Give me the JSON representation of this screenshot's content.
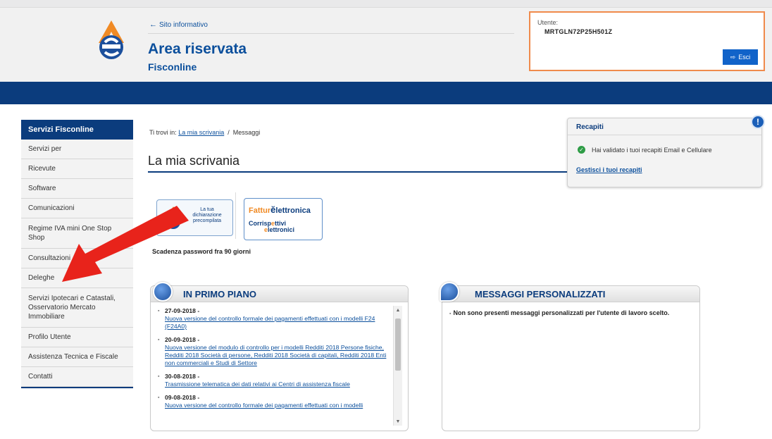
{
  "header": {
    "back_link": "Sito informativo",
    "title": "Area riservata",
    "subtitle": "Fisconline",
    "user_label": "Utente:",
    "user_code": "MRTGLN72P25H501Z",
    "logout_label": "Esci"
  },
  "sidebar": {
    "heading": "Servizi Fisconline",
    "items": [
      {
        "label": "Servizi per"
      },
      {
        "label": "Ricevute"
      },
      {
        "label": "Software"
      },
      {
        "label": "Comunicazioni"
      },
      {
        "label": "Regime IVA mini One Stop Shop"
      },
      {
        "label": "Consultazioni"
      },
      {
        "label": "Deleghe"
      },
      {
        "label": "Servizi Ipotecari e Catastali, Osservatorio Mercato Immobiliare"
      },
      {
        "label": "Profilo Utente"
      },
      {
        "label": "Assistenza Tecnica e Fiscale"
      },
      {
        "label": "Contatti"
      }
    ]
  },
  "breadcrumb": {
    "prefix": "Ti trovi in:",
    "link": "La mia scrivania",
    "separator": "/",
    "current": "Messaggi"
  },
  "main": {
    "title": "La mia scrivania",
    "password_notice": "Scadenza password fra 90 giorni"
  },
  "recapiti": {
    "title": "Recapiti",
    "message": "Hai validato i tuoi recapiti Email e Cellulare",
    "link": "Gestisci i tuoi recapiti"
  },
  "buttons": {
    "dichiarazione": "La tua dichiarazione precompilata",
    "fattura_part1": "Fattur",
    "fattura_part2": "lettronica",
    "corrisp_part1": "Corrisp",
    "corrisp_part2": "ttivi",
    "corrisp_part3": "lettronici"
  },
  "primo_piano": {
    "title": "IN PRIMO PIANO",
    "items": [
      {
        "date": "27-09-2018 -",
        "text": "Nuova versione del controllo formale dei pagamenti effettuati con i modelli F24 (F24A0)"
      },
      {
        "date": "20-09-2018 -",
        "text": "Nuova versione del modulo di controllo per i modelli Redditi 2018 Persone fisiche, Redditi 2018 Società di persone, Redditi 2018 Società di capitali, Redditi 2018 Enti non commerciali e Studi di Settore"
      },
      {
        "date": "30-08-2018 -",
        "text": "Trasmissione telematica dei dati relativi ai Centri di assistenza fiscale"
      },
      {
        "date": "09-08-2018 -",
        "text": "Nuova versione del controllo formale dei pagamenti effettuati con i modelli"
      }
    ]
  },
  "messaggi": {
    "title": "MESSAGGI PERSONALIZZATI",
    "text": "Non sono presenti messaggi personalizzati per l'utente di lavoro scelto."
  },
  "colors": {
    "brand_navy": "#0b3c7d",
    "link_blue": "#0b4f9c",
    "accent_orange": "#f08a4b",
    "button_blue": "#1163c9",
    "annotation_red": "#e8231b"
  },
  "icons": [
    "agenzia-entrate-logo",
    "back-arrow-icon",
    "logout-icon",
    "check-circle-icon",
    "info-icon",
    "news-globe-icon",
    "message-bubble-icon",
    "red-arrow-annotation"
  ]
}
